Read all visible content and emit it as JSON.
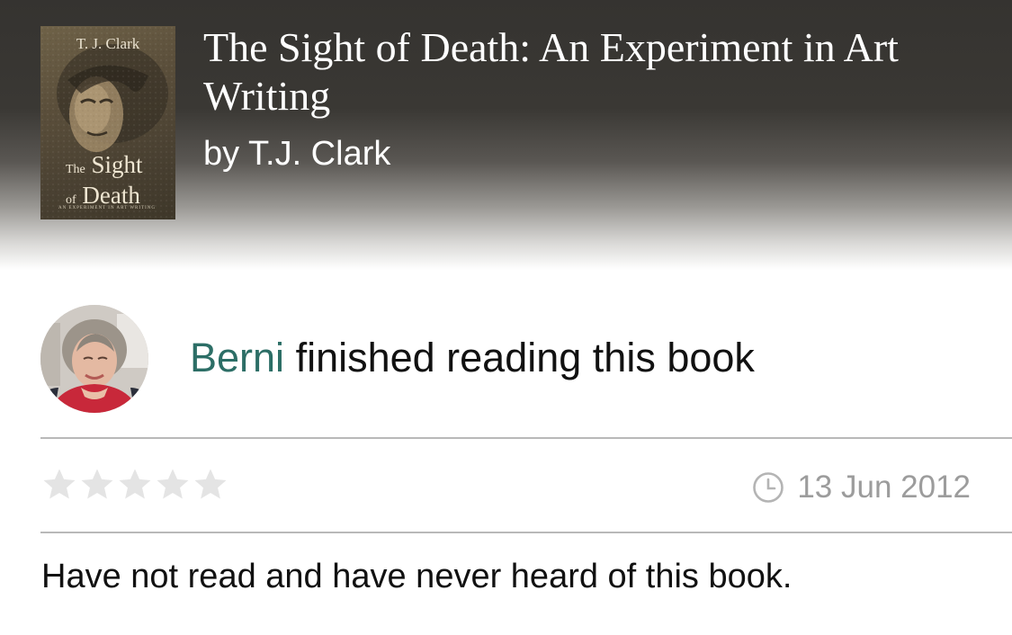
{
  "book": {
    "title": "The Sight of Death: An Experiment in Art Writing",
    "author": "by T.J. Clark",
    "cover": {
      "author": "T. J. Clark",
      "title_small": "The",
      "title_line1": "Sight",
      "title_small2": "of",
      "title_line2": "Death",
      "subtitle": "AN EXPERIMENT IN ART WRITING"
    }
  },
  "activity": {
    "user": "Berni",
    "action": " finished reading this book"
  },
  "review": {
    "rating": 0,
    "max_rating": 5,
    "date": "13 Jun 2012",
    "text": "Have not read and have never heard of this book."
  },
  "colors": {
    "user_link": "#2c6e66",
    "star_empty": "#e4e4e4",
    "date_gray": "#9c9c9c"
  },
  "icons": {
    "date": "clock-icon",
    "rating": "star-icon"
  }
}
